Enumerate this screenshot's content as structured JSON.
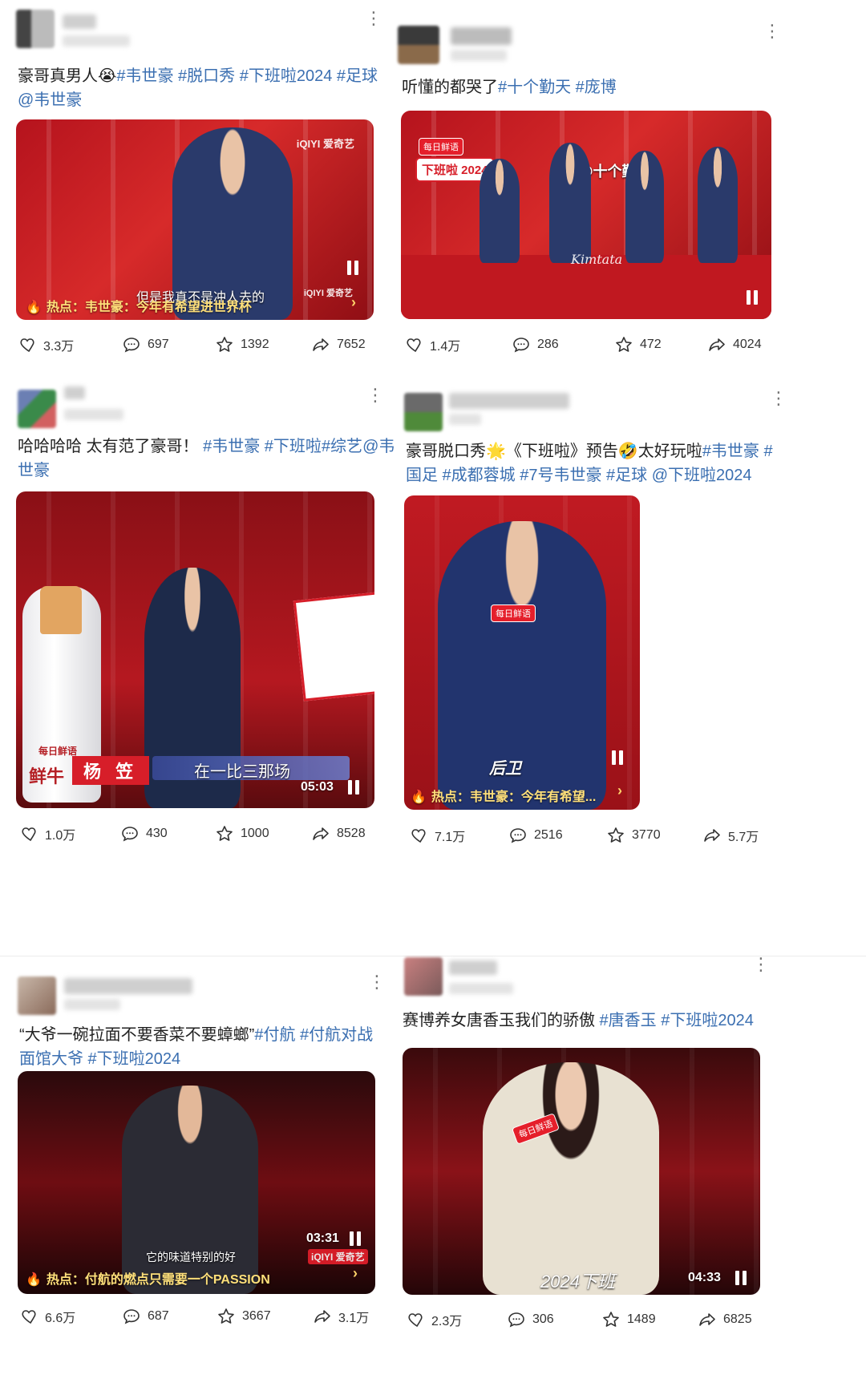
{
  "posts": [
    {
      "caption_text": "豪哥真男人😭",
      "tags": [
        "#韦世豪",
        " #脱口秀",
        " #下班啦2024",
        " #足球"
      ],
      "caption_line2": "@韦世豪",
      "video": {
        "brand": "iQIYI 爱奇艺",
        "hot": "热点：韦世豪：今年有希望进世界杯",
        "subtitle": "但是我真不是冲人去的",
        "watermark": "iQIYI 爱奇艺"
      },
      "stats": {
        "likes": "3.3万",
        "comments": "697",
        "favorites": "1392",
        "shares": "7652"
      }
    },
    {
      "caption_text": "听懂的都哭了",
      "tags": [
        "#十个勤天",
        " #庞博"
      ],
      "video": {
        "badge": "每日鲜语",
        "show_title": "下班啦 2024",
        "overlay": "@十个勤天",
        "signature": "Kimtata"
      },
      "stats": {
        "likes": "1.4万",
        "comments": "286",
        "favorites": "472",
        "shares": "4024"
      }
    },
    {
      "caption_text": "哈哈哈哈 太有范了豪哥！",
      "tags": [
        " #韦世豪",
        " #下班啦",
        "#综艺",
        "@韦"
      ],
      "caption_line2": "世豪",
      "video": {
        "name_tag": "杨 笠",
        "subtitle": "在一比三那场",
        "duration": "05:03",
        "bottle": "每日鲜语",
        "bottle2": "鲜牛"
      },
      "stats": {
        "likes": "1.0万",
        "comments": "430",
        "favorites": "1000",
        "shares": "8528"
      }
    },
    {
      "caption_text": "豪哥脱口秀🌟《下班啦》预告🤣太好玩啦",
      "tags": [
        "#韦世豪",
        " #"
      ],
      "caption_line2_tags": [
        "国足",
        " #成都蓉城",
        " #7号韦世豪",
        " #足球",
        " @下班啦2024"
      ],
      "video": {
        "badge": "每日鲜语",
        "subtitle": "后卫",
        "hot": "热点：韦世豪：今年有希望..."
      },
      "stats": {
        "likes": "7.1万",
        "comments": "2516",
        "favorites": "3770",
        "shares": "5.7万"
      }
    },
    {
      "caption_text": "“大爷一碗拉面不要香菜不要蟑螂”",
      "tags": [
        "#付航",
        " #付航对战"
      ],
      "caption_line2": "面馆大爷",
      "caption_line2_tag": " #下班啦2024",
      "video": {
        "duration": "03:31",
        "subtitle": "它的味道特别的好",
        "hot": "热点：付航的燃点只需要一个PASSION",
        "watermark": "iQIYI 爱奇艺"
      },
      "stats": {
        "likes": "6.6万",
        "comments": "687",
        "favorites": "3667",
        "shares": "3.1万"
      }
    },
    {
      "caption_text": "赛博养女唐香玉我们的骄傲",
      "tags": [
        " #唐香玉",
        " #下班啦2024"
      ],
      "video": {
        "badge": "每日鲜语",
        "subtitle": "2024下班",
        "duration": "04:33"
      },
      "stats": {
        "likes": "2.3万",
        "comments": "306",
        "favorites": "1489",
        "shares": "6825"
      }
    }
  ],
  "icons": {
    "like": "heart-icon",
    "comment": "comment-icon",
    "favorite": "star-icon",
    "share": "share-icon",
    "more": "more-icon"
  }
}
